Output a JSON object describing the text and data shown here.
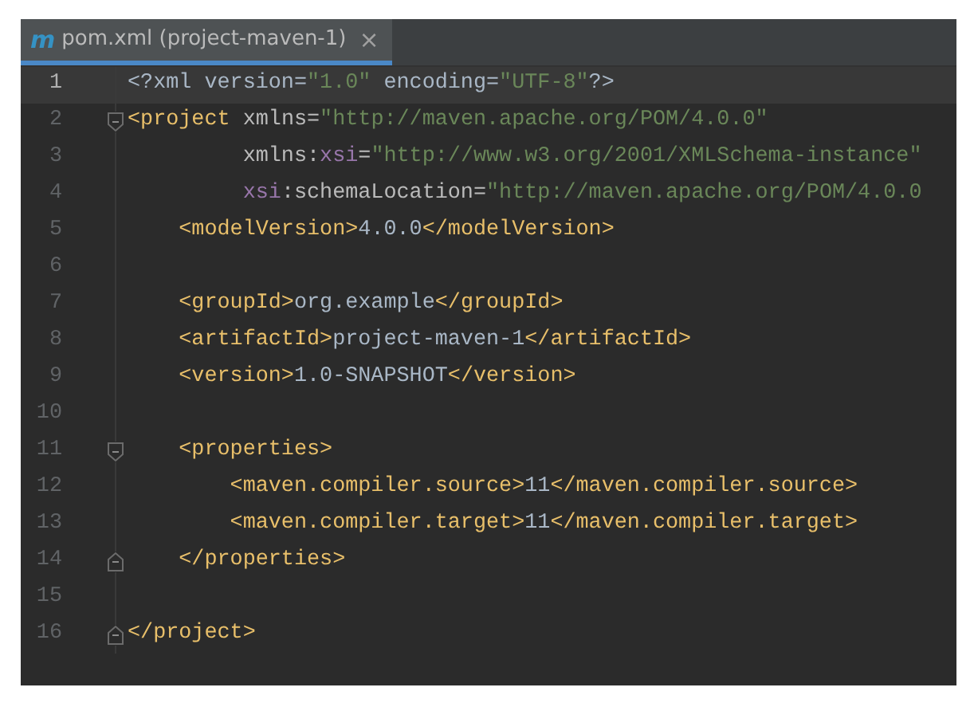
{
  "tab": {
    "icon_glyph": "m",
    "title": "pom.xml (project-maven-1)",
    "close_glyph": "×",
    "selected": true
  },
  "lines": [
    {
      "number": "1",
      "current": true,
      "fold_start": false,
      "fold_end": false,
      "tokens": [
        {
          "kind": "plain",
          "text": "<?xml version="
        },
        {
          "kind": "value",
          "text": "\"1.0\""
        },
        {
          "kind": "plain",
          "text": " encoding="
        },
        {
          "kind": "value",
          "text": "\"UTF-8\""
        },
        {
          "kind": "plain",
          "text": "?>"
        }
      ]
    },
    {
      "number": "2",
      "current": false,
      "fold_start": true,
      "fold_end": false,
      "tokens": [
        {
          "kind": "tag",
          "text": "<project"
        },
        {
          "kind": "attr",
          "text": " xmlns="
        },
        {
          "kind": "value",
          "text": "\"http://maven.apache.org/POM/4.0.0\""
        }
      ]
    },
    {
      "number": "3",
      "current": false,
      "fold_start": false,
      "fold_end": false,
      "tokens": [
        {
          "kind": "attr",
          "text": "         xmlns:"
        },
        {
          "kind": "ns",
          "text": "xsi"
        },
        {
          "kind": "attr",
          "text": "="
        },
        {
          "kind": "value",
          "text": "\"http://www.w3.org/2001/XMLSchema-instance\""
        }
      ]
    },
    {
      "number": "4",
      "current": false,
      "fold_start": false,
      "fold_end": false,
      "tokens": [
        {
          "kind": "ns",
          "text": "         xsi"
        },
        {
          "kind": "attr",
          "text": ":schemaLocation="
        },
        {
          "kind": "value",
          "text": "\"http://maven.apache.org/POM/4.0.0"
        }
      ]
    },
    {
      "number": "5",
      "current": false,
      "fold_start": false,
      "fold_end": false,
      "tokens": [
        {
          "kind": "tag",
          "text": "    <modelVersion>"
        },
        {
          "kind": "plain",
          "text": "4.0.0"
        },
        {
          "kind": "tag",
          "text": "</modelVersion>"
        }
      ]
    },
    {
      "number": "6",
      "current": false,
      "fold_start": false,
      "fold_end": false
    },
    {
      "number": "7",
      "current": false,
      "fold_start": false,
      "fold_end": false,
      "tokens": [
        {
          "kind": "tag",
          "text": "    <groupId>"
        },
        {
          "kind": "plain",
          "text": "org.example"
        },
        {
          "kind": "tag",
          "text": "</groupId>"
        }
      ]
    },
    {
      "number": "8",
      "current": false,
      "fold_start": false,
      "fold_end": false,
      "tokens": [
        {
          "kind": "tag",
          "text": "    <artifactId>"
        },
        {
          "kind": "plain",
          "text": "project-maven-1"
        },
        {
          "kind": "tag",
          "text": "</artifactId>"
        }
      ]
    },
    {
      "number": "9",
      "current": false,
      "fold_start": false,
      "fold_end": false,
      "tokens": [
        {
          "kind": "tag",
          "text": "    <version>"
        },
        {
          "kind": "plain",
          "text": "1.0-SNAPSHOT"
        },
        {
          "kind": "tag",
          "text": "</version>"
        }
      ]
    },
    {
      "number": "10",
      "current": false,
      "fold_start": false,
      "fold_end": false
    },
    {
      "number": "11",
      "current": false,
      "fold_start": true,
      "fold_end": false,
      "tokens": [
        {
          "kind": "tag",
          "text": "    <properties>"
        }
      ]
    },
    {
      "number": "12",
      "current": false,
      "fold_start": false,
      "fold_end": false,
      "tokens": [
        {
          "kind": "tag",
          "text": "        <maven.compiler.source>"
        },
        {
          "kind": "plain",
          "text": "11"
        },
        {
          "kind": "tag",
          "text": "</maven.compiler.source>"
        }
      ]
    },
    {
      "number": "13",
      "current": false,
      "fold_start": false,
      "fold_end": false,
      "tokens": [
        {
          "kind": "tag",
          "text": "        <maven.compiler.target>"
        },
        {
          "kind": "plain",
          "text": "11"
        },
        {
          "kind": "tag",
          "text": "</maven.compiler.target>"
        }
      ]
    },
    {
      "number": "14",
      "current": false,
      "fold_start": false,
      "fold_end": true,
      "tokens": [
        {
          "kind": "tag",
          "text": "    </properties>"
        }
      ]
    },
    {
      "number": "15",
      "current": false,
      "fold_start": false,
      "fold_end": false
    },
    {
      "number": "16",
      "current": false,
      "fold_start": false,
      "fold_end": true,
      "tokens": [
        {
          "kind": "tag",
          "text": "</project>"
        }
      ]
    }
  ]
}
